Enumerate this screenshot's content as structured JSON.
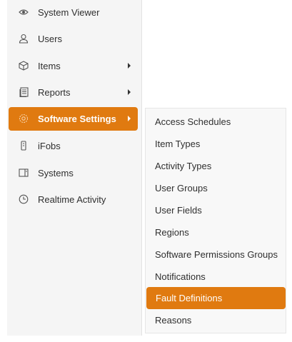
{
  "sidebar": {
    "items": [
      {
        "label": "System Viewer",
        "icon": "eye-icon",
        "has_submenu": false
      },
      {
        "label": "Users",
        "icon": "user-icon",
        "has_submenu": false
      },
      {
        "label": "Items",
        "icon": "cube-icon",
        "has_submenu": true
      },
      {
        "label": "Reports",
        "icon": "report-icon",
        "has_submenu": true
      },
      {
        "label": "Software Settings",
        "icon": "gear-icon",
        "has_submenu": true,
        "active": true
      },
      {
        "label": "iFobs",
        "icon": "fob-icon",
        "has_submenu": false
      },
      {
        "label": "Systems",
        "icon": "systems-icon",
        "has_submenu": false
      },
      {
        "label": "Realtime Activity",
        "icon": "clock-icon",
        "has_submenu": false
      }
    ]
  },
  "submenu": {
    "items": [
      {
        "label": "Access Schedules"
      },
      {
        "label": "Item Types"
      },
      {
        "label": "Activity Types"
      },
      {
        "label": "User Groups"
      },
      {
        "label": "User Fields"
      },
      {
        "label": "Regions"
      },
      {
        "label": "Software Permissions Groups"
      },
      {
        "label": "Notifications"
      },
      {
        "label": "Fault Definitions",
        "active": true
      },
      {
        "label": "Reasons"
      }
    ]
  },
  "colors": {
    "accent": "#e07a10",
    "sidebar_bg": "#f5f5f5",
    "submenu_bg": "#f8f8f8",
    "text": "#2f2f2f"
  }
}
